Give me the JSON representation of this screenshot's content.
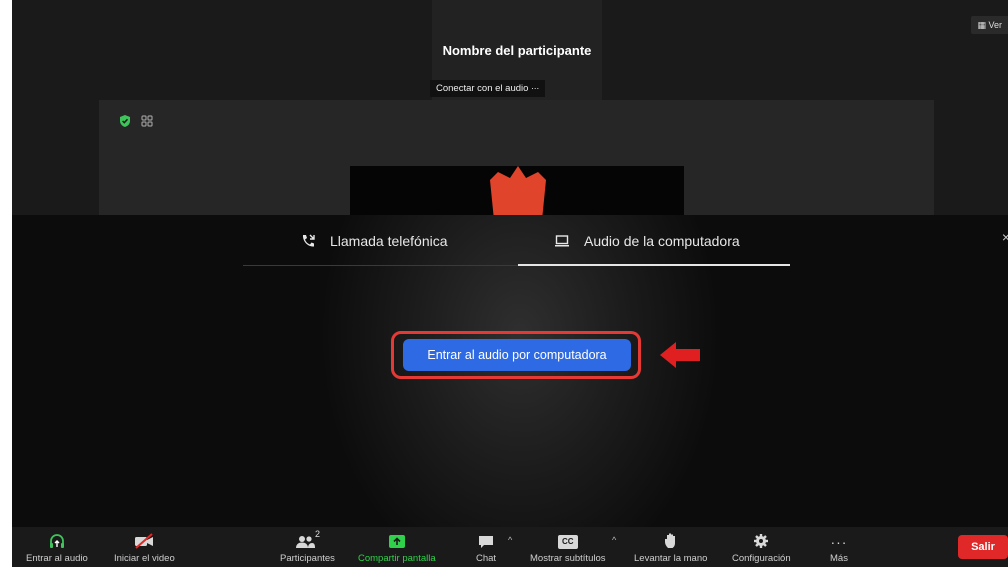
{
  "header": {
    "participant_name": "Nombre del participante",
    "audio_hint": "Conectar con el audio",
    "view_label": "Ver"
  },
  "dialog": {
    "tabs": [
      {
        "label": "Llamada telefónica",
        "icon": "phone-call-icon",
        "selected": false
      },
      {
        "label": "Audio de la computadora",
        "icon": "laptop-icon",
        "selected": true
      }
    ],
    "join_button": "Entrar al audio por computadora",
    "close": "×"
  },
  "toolbar": {
    "join_audio": "Entrar al audio",
    "start_video": "Iniciar el video",
    "participants": "Participantes",
    "participants_count": "2",
    "share_screen": "Compartir pantalla",
    "chat": "Chat",
    "captions": "Mostrar subtítulos",
    "captions_icon_text": "CC",
    "raise_hand": "Levantar la mano",
    "settings": "Configuración",
    "more": "Más",
    "leave": "Salir"
  },
  "colors": {
    "primary_button": "#2d6ae3",
    "highlight": "#e53935",
    "share_green": "#2fd14a",
    "leave_red": "#e02828",
    "background": "#1a1a1a"
  }
}
